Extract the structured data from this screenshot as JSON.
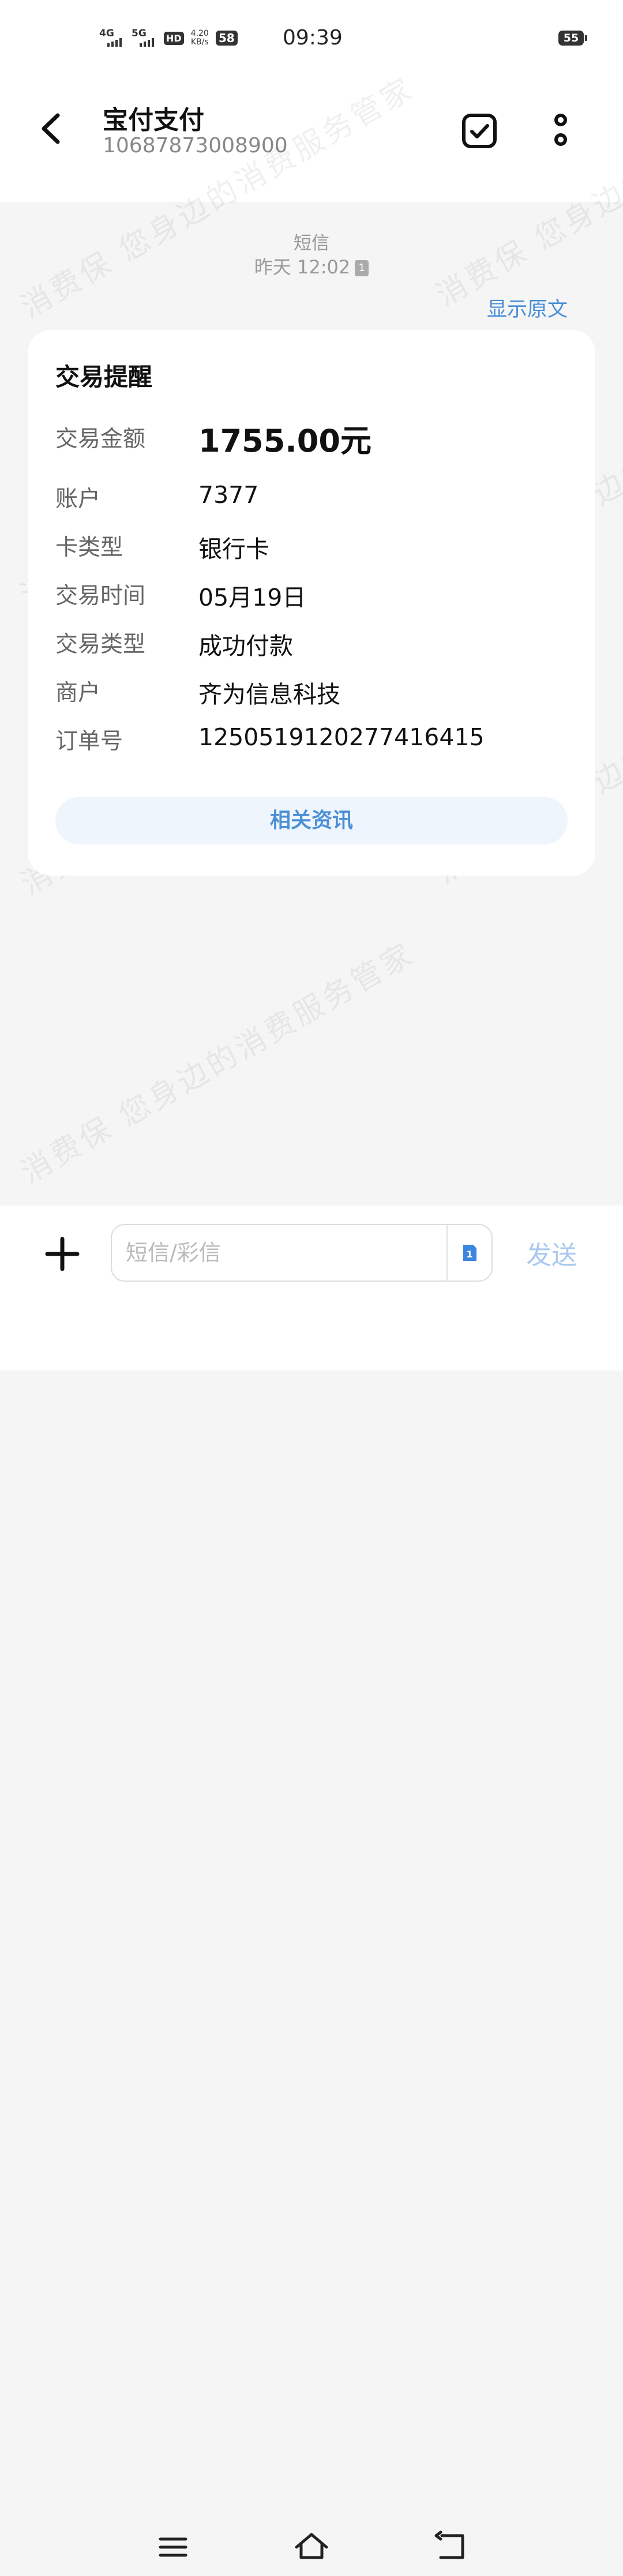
{
  "status_bar": {
    "signal_1": "4G",
    "signal_2": "5G",
    "hd_badge": "HD",
    "net_speed_value": "4.20",
    "net_speed_unit": "KB/s",
    "notification_count": "58",
    "time": "09:39",
    "battery": "55"
  },
  "header": {
    "title": "宝付支付",
    "subtitle": "10687873008900"
  },
  "message": {
    "type_label": "短信",
    "time": "昨天 12:02",
    "sim_slot": "1",
    "show_original": "显示原文"
  },
  "card": {
    "title": "交易提醒",
    "rows": [
      {
        "label": "交易金额",
        "value": "1755.00元"
      },
      {
        "label": "账户",
        "value": "7377"
      },
      {
        "label": "卡类型",
        "value": "银行卡"
      },
      {
        "label": "交易时间",
        "value": "05月19日"
      },
      {
        "label": "交易类型",
        "value": "成功付款"
      },
      {
        "label": "商户",
        "value": "齐为信息科技"
      },
      {
        "label": "订单号",
        "value": "1250519120277416415"
      }
    ],
    "news_button": "相关资讯"
  },
  "watermark": {
    "text_1": "消费保 您身边的消费服务管家",
    "text_2": "消费保 您身边的消费服务管家"
  },
  "composer": {
    "placeholder": "短信/彩信",
    "sim_slot": "1",
    "send_label": "发送"
  },
  "colors": {
    "accent": "#4a8fd6",
    "send_disabled": "#a9c9ee",
    "background": "#f5f5f5"
  }
}
